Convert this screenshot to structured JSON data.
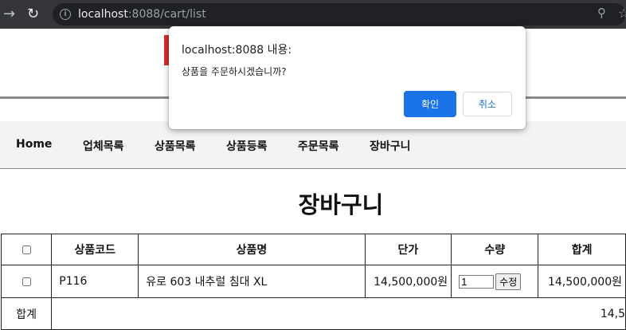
{
  "browser": {
    "url_host": "localhost",
    "url_rest": ":8088/cart/list"
  },
  "menu": {
    "items": [
      "Home",
      "업체목록",
      "상품목록",
      "상품등록",
      "주문목록",
      "장바구니"
    ]
  },
  "page": {
    "title": "장바구니"
  },
  "cart": {
    "columns": [
      "상품코드",
      "상품명",
      "단가",
      "수량",
      "합계"
    ],
    "rows": [
      {
        "code": "P116",
        "name": "유로 603 내추럴 침대 XL",
        "price": "14,500,000원",
        "qty": "1",
        "update_label": "수정",
        "subtotal": "14,500,000원"
      }
    ],
    "total_label": "합계",
    "total_value": "14,5"
  },
  "dialog": {
    "title": "localhost:8088 내용:",
    "message": "상품을 주문하시겠습니까?",
    "ok_label": "확인",
    "cancel_label": "취소"
  },
  "colors": {
    "accent": "#1a73e8",
    "brand_red": "#d32f2f",
    "chrome": "#35363a"
  }
}
